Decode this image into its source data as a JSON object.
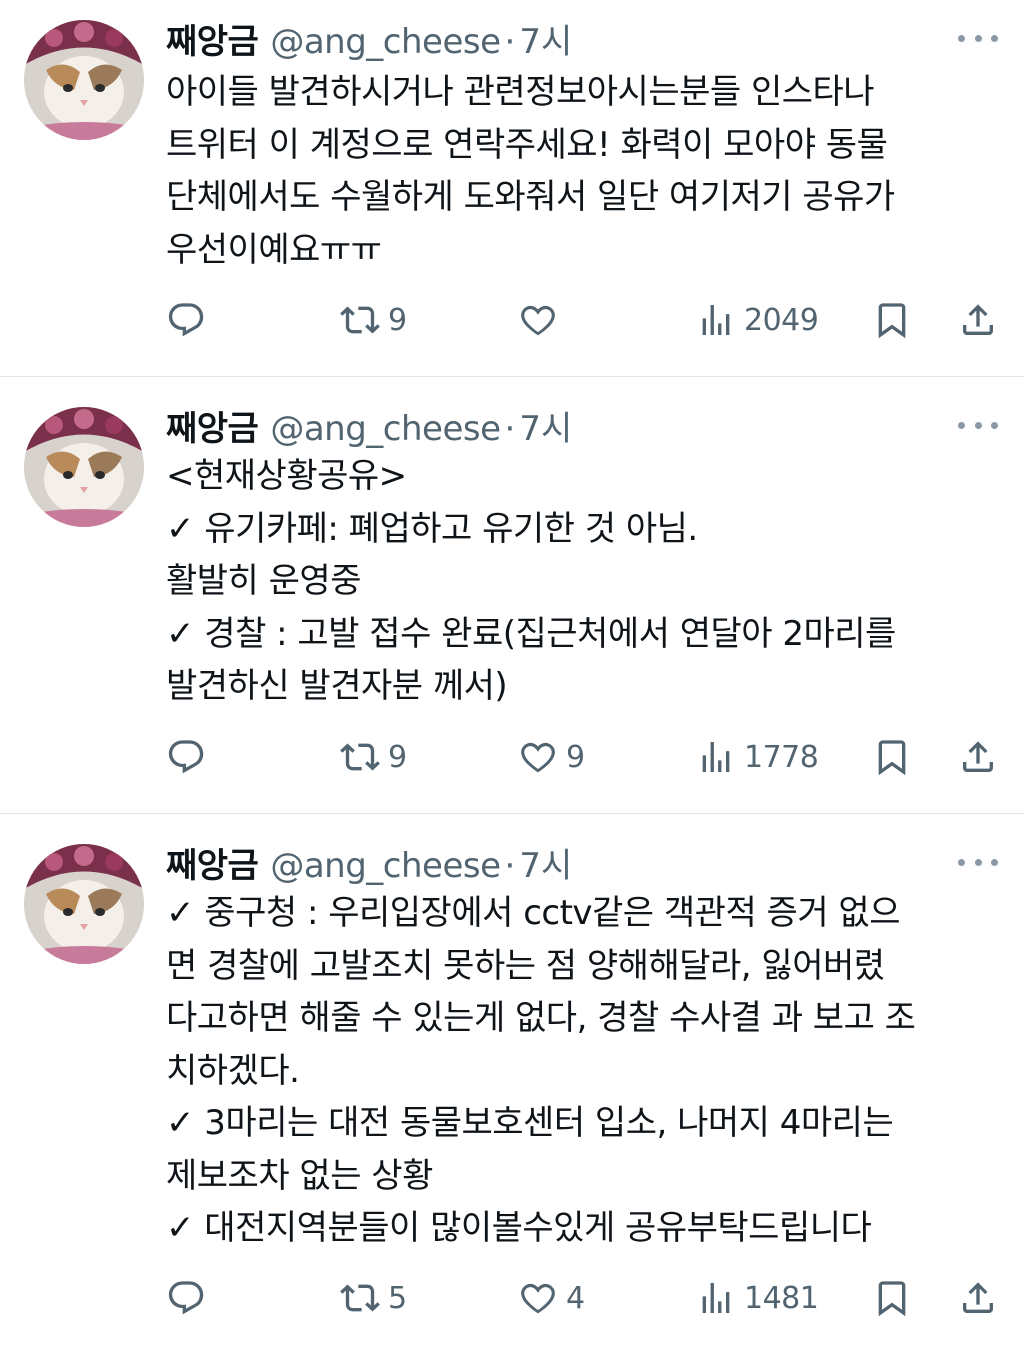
{
  "tweets": [
    {
      "name": "째앙금",
      "handle": "@ang_cheese",
      "dot": "·",
      "time": "7시",
      "lines": [
        "아이들 발견하시거나 관련정보아시는분들 인스타나",
        "트위터 이 계정으로 연락주세요! 화력이 모아야 동물",
        "단체에서도 수월하게 도와줘서 일단 여기저기 공유가",
        "우선이예요ㅠㅠ"
      ],
      "retweets": "9",
      "likes": "",
      "views": "2049"
    },
    {
      "name": "째앙금",
      "handle": "@ang_cheese",
      "dot": "·",
      "time": "7시",
      "lines": [
        "<현재상황공유>",
        "✓ 유기카페: 폐업하고 유기한 것 아님.",
        "활발히 운영중",
        "✓ 경찰 : 고발 접수 완료(집근처에서 연달아 2마리를",
        "발견하신 발견자분 께서)"
      ],
      "retweets": "9",
      "likes": "9",
      "views": "1778"
    },
    {
      "name": "째앙금",
      "handle": "@ang_cheese",
      "dot": "·",
      "time": "7시",
      "lines": [
        "✓ 중구청 : 우리입장에서 cctv같은 객관적 증거 없으",
        "면 경찰에 고발조치 못하는 점 양해해달라, 잃어버렸",
        "다고하면 해줄 수 있는게 없다, 경찰 수사결 과 보고 조",
        "치하겠다.",
        "✓ 3마리는 대전 동물보호센터 입소, 나머지 4마리는",
        "제보조차 없는 상황",
        "✓ 대전지역분들이 많이볼수있게 공유부탁드립니다"
      ],
      "retweets": "5",
      "likes": "4",
      "views": "1481"
    }
  ],
  "icons": {
    "reply": "reply-icon",
    "retweet": "retweet-icon",
    "like": "heart-icon",
    "views": "views-icon",
    "bookmark": "bookmark-icon",
    "share": "share-icon",
    "more": "more-icon"
  },
  "colors": {
    "text": "#0f1419",
    "secondary": "#536471",
    "divider": "#e1e6ea"
  }
}
